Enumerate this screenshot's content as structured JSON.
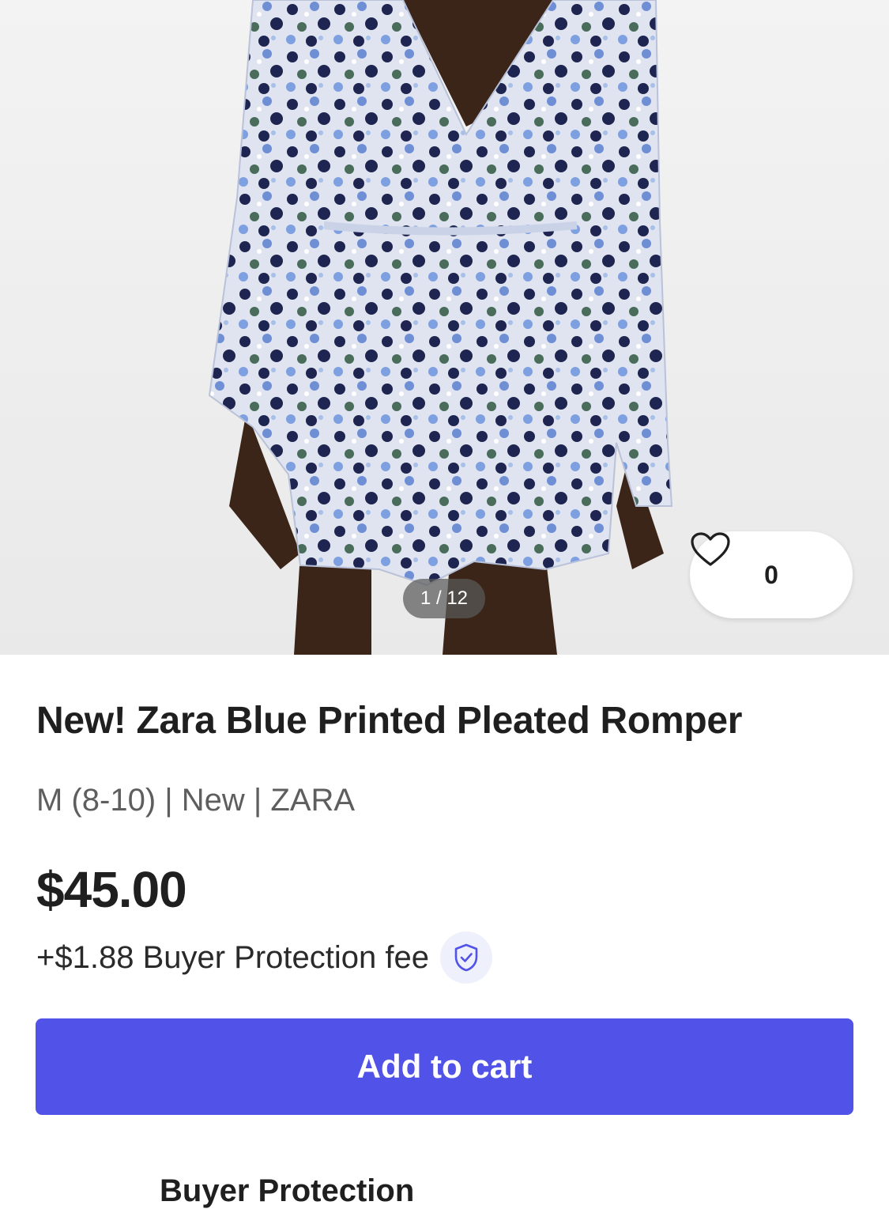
{
  "product": {
    "image_counter": "1 / 12",
    "like_count": "0",
    "title": "New! Zara Blue Printed Pleated Romper",
    "meta": "M (8-10) | New | ZARA",
    "price": "$45.00",
    "fee": "+$1.88 Buyer Protection fee"
  },
  "actions": {
    "add_to_cart": "Add to cart"
  },
  "sections": {
    "next_heading": "Buyer Protection"
  },
  "colors": {
    "accent": "#5152e8",
    "shield_bg": "#eef0fb"
  },
  "icons": {
    "like": "heart-icon",
    "protection": "shield-check-icon"
  }
}
